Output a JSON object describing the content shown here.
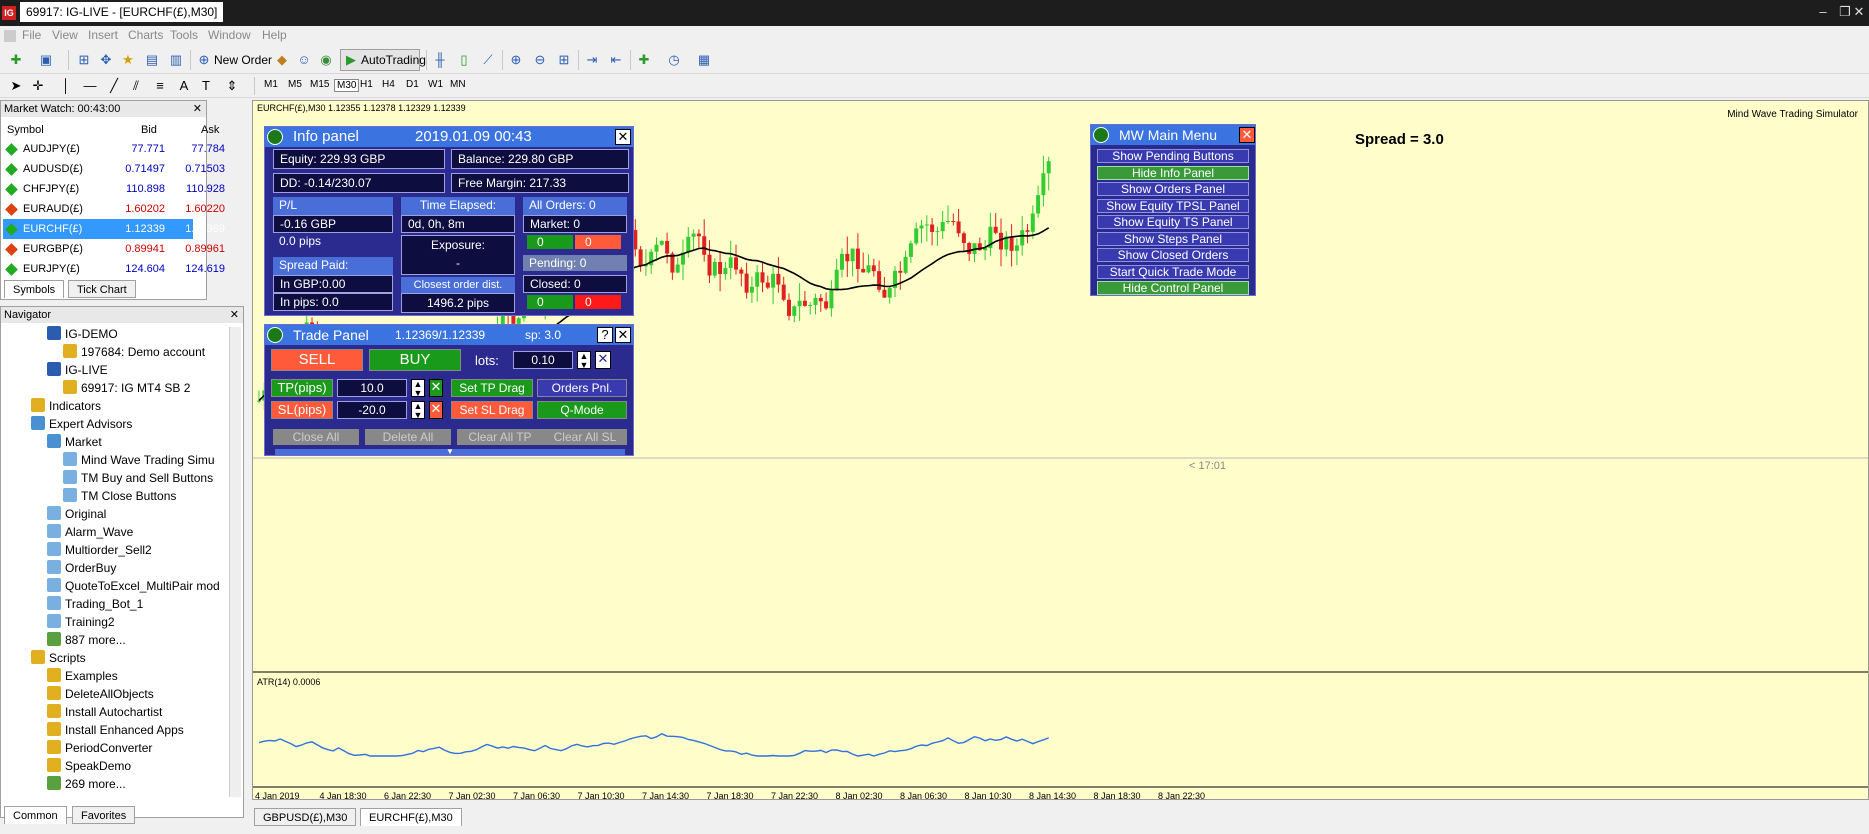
{
  "window": {
    "title": "69917: IG-LIVE - [EURCHF(£),M30]"
  },
  "menu": [
    "File",
    "View",
    "Insert",
    "Charts",
    "Tools",
    "Window",
    "Help"
  ],
  "toolbar": {
    "new_order": "New Order",
    "autotrading": "AutoTrading"
  },
  "timeframes": [
    "M1",
    "M5",
    "M15",
    "M30",
    "H1",
    "H4",
    "D1",
    "W1",
    "MN"
  ],
  "market_watch": {
    "title": "Market Watch: 00:43:00",
    "col_symbol": "Symbol",
    "col_bid": "Bid",
    "col_ask": "Ask",
    "rows": [
      {
        "symbol": "AUDJPY(£)",
        "bid": "77.771",
        "ask": "77.784",
        "dir": "up"
      },
      {
        "symbol": "AUDUSD(£)",
        "bid": "0.71497",
        "ask": "0.71503",
        "dir": "up"
      },
      {
        "symbol": "CHFJPY(£)",
        "bid": "110.898",
        "ask": "110.928",
        "dir": "up"
      },
      {
        "symbol": "EURAUD(£)",
        "bid": "1.60202",
        "ask": "1.60220",
        "dir": "down"
      },
      {
        "symbol": "EURCHF(£)",
        "bid": "1.12339",
        "ask": "1.12369",
        "dir": "up"
      },
      {
        "symbol": "EURGBP(£)",
        "bid": "0.89941",
        "ask": "0.89961",
        "dir": "down"
      },
      {
        "symbol": "EURJPY(£)",
        "bid": "124.604",
        "ask": "124.619",
        "dir": "up"
      }
    ],
    "tabs": [
      "Symbols",
      "Tick Chart"
    ]
  },
  "navigator": {
    "title": "Navigator",
    "items": [
      {
        "label": "IG-DEMO",
        "indent": 2,
        "icon": "#2a5db0"
      },
      {
        "label": "197684: Demo account",
        "indent": 3,
        "icon": "#e0b020"
      },
      {
        "label": "IG-LIVE",
        "indent": 2,
        "icon": "#2a5db0"
      },
      {
        "label": "69917: IG MT4 SB 2",
        "indent": 3,
        "icon": "#e0b020"
      },
      {
        "label": "Indicators",
        "indent": 1,
        "icon": "#e0b020"
      },
      {
        "label": "Expert Advisors",
        "indent": 1,
        "icon": "#4a90d0"
      },
      {
        "label": "Market",
        "indent": 2,
        "icon": "#4a90d0"
      },
      {
        "label": "Mind Wave Trading Simu",
        "indent": 3,
        "icon": "#7ab0e0"
      },
      {
        "label": "TM Buy and Sell Buttons",
        "indent": 3,
        "icon": "#7ab0e0"
      },
      {
        "label": "TM Close Buttons",
        "indent": 3,
        "icon": "#7ab0e0"
      },
      {
        "label": "Original",
        "indent": 2,
        "icon": "#7ab0e0"
      },
      {
        "label": "Alarm_Wave",
        "indent": 2,
        "icon": "#7ab0e0"
      },
      {
        "label": "Multiorder_Sell2",
        "indent": 2,
        "icon": "#7ab0e0"
      },
      {
        "label": "OrderBuy",
        "indent": 2,
        "icon": "#7ab0e0"
      },
      {
        "label": "QuoteToExcel_MultiPair mod",
        "indent": 2,
        "icon": "#7ab0e0"
      },
      {
        "label": "Trading_Bot_1",
        "indent": 2,
        "icon": "#7ab0e0"
      },
      {
        "label": "Training2",
        "indent": 2,
        "icon": "#7ab0e0"
      },
      {
        "label": "887 more...",
        "indent": 2,
        "icon": "#5aa040"
      },
      {
        "label": "Scripts",
        "indent": 1,
        "icon": "#e0b020"
      },
      {
        "label": "Examples",
        "indent": 2,
        "icon": "#e0b020"
      },
      {
        "label": "DeleteAllObjects",
        "indent": 2,
        "icon": "#e0b020"
      },
      {
        "label": "Install Autochartist",
        "indent": 2,
        "icon": "#e0b020"
      },
      {
        "label": "Install Enhanced Apps",
        "indent": 2,
        "icon": "#e0b020"
      },
      {
        "label": "PeriodConverter",
        "indent": 2,
        "icon": "#e0b020"
      },
      {
        "label": "SpeakDemo",
        "indent": 2,
        "icon": "#e0b020"
      },
      {
        "label": "269 more...",
        "indent": 2,
        "icon": "#5aa040"
      }
    ],
    "tabs": [
      "Common",
      "Favorites"
    ]
  },
  "chart": {
    "header": "EURCHF(£),M30  1.12355 1.12378 1.12329 1.12339",
    "watermark": "Mind Wave Trading Simulator",
    "spread": "Spread = 3.0",
    "price_tag": "< 17:01",
    "indicator_label": "ATR(14) 0.0006",
    "time_labels": [
      "4 Jan 2019",
      "4 Jan 18:30",
      "6 Jan 22:30",
      "7 Jan 02:30",
      "7 Jan 06:30",
      "7 Jan 10:30",
      "7 Jan 14:30",
      "7 Jan 18:30",
      "7 Jan 22:30",
      "8 Jan 02:30",
      "8 Jan 06:30",
      "8 Jan 10:30",
      "8 Jan 14:30",
      "8 Jan 18:30",
      "8 Jan 22:30"
    ],
    "colors": {
      "bull": "#33cc33",
      "bear": "#dd2222",
      "ma": "#000000",
      "atr": "#3070e0"
    }
  },
  "info_panel": {
    "title": "Info panel",
    "date": "2019.01.09 00:43",
    "equity": "Equity: 229.93 GBP",
    "balance": "Balance: 229.80 GBP",
    "dd": "DD: -0.14/230.07",
    "free_margin": "Free Margin: 217.33",
    "pl_label": "P/L",
    "pl_gbp": "-0.16 GBP",
    "pl_pips": "0.0 pips",
    "time_label": "Time Elapsed:",
    "time_value": "0d, 0h, 8m",
    "exposure_label": "Exposure:",
    "exposure_value": "-",
    "closest_label": "Closest order dist.",
    "closest_value": "1496.2 pips",
    "spread_label": "Spread Paid:",
    "spread_gbp": "In GBP:0.00",
    "spread_pips": "In pips: 0.0",
    "all_orders": "All Orders: 0",
    "market": "Market: 0",
    "market_buy": "0",
    "market_sell": "0",
    "pending": "Pending: 0",
    "closed": "Closed: 0",
    "closed_buy": "0",
    "closed_sell": "0"
  },
  "trade_panel": {
    "title": "Trade Panel",
    "quote": "1.12369/1.12339",
    "sp": "sp: 3.0",
    "sell": "SELL",
    "buy": "BUY",
    "lots_label": "lots:",
    "lots": "0.10",
    "tp_label": "TP(pips)",
    "tp": "10.0",
    "sl_label": "SL(pips)",
    "sl": "-20.0",
    "set_tp": "Set TP Drag",
    "set_sl": "Set SL Drag",
    "orders_pnl": "Orders Pnl.",
    "qmode": "Q-Mode",
    "close_all": "Close All",
    "delete_all": "Delete All",
    "clear_tp": "Clear All TP",
    "clear_sl": "Clear All SL"
  },
  "mw_menu": {
    "title": "MW Main Menu",
    "items": [
      {
        "label": "Show Pending Buttons",
        "style": "b"
      },
      {
        "label": "Hide Info Panel",
        "style": "g"
      },
      {
        "label": "Show Orders Panel",
        "style": "b"
      },
      {
        "label": "Show Equity TPSL Panel",
        "style": "b"
      },
      {
        "label": "Show Equity TS Panel",
        "style": "b"
      },
      {
        "label": "Show Steps Panel",
        "style": "b"
      },
      {
        "label": "Show Closed Orders",
        "style": "b"
      },
      {
        "label": "Start Quick Trade Mode",
        "style": "b"
      },
      {
        "label": "Hide Control Panel",
        "style": "g"
      }
    ]
  },
  "chart_tabs": [
    "GBPUSD(£),M30",
    "EURCHF(£),M30"
  ]
}
